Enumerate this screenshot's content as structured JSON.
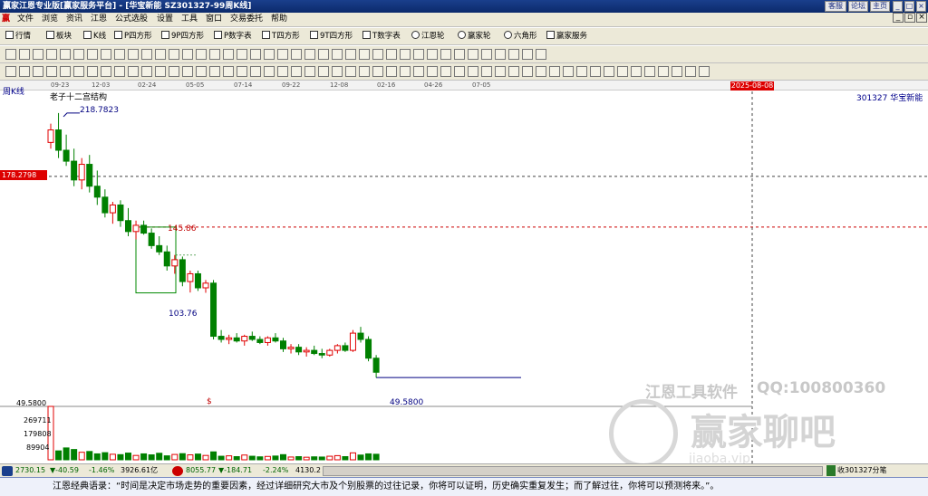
{
  "window": {
    "title": "赢家江恩专业版[赢家服务平台] - [华宝新能   SZ301327-99周K线]",
    "btn_advisor": "客服",
    "btn_forum": "论坛",
    "btn_home": "主页"
  },
  "menu": [
    "文件",
    "浏览",
    "资讯",
    "江恩",
    "公式选股",
    "设置",
    "工具",
    "窗口",
    "交易委托",
    "帮助"
  ],
  "toolbar1": [
    "行情",
    "板块",
    "K线",
    "P四方形",
    "9P四方形",
    "P数字表",
    "T四方形",
    "9T四方形",
    "T数字表",
    "江恩轮",
    "赢家轮",
    "六角形",
    "赢家服务"
  ],
  "chart": {
    "period_label": "周K线",
    "study_label": "老子十二宫结构",
    "stock_label": "301327  华宝新能",
    "date_ticks": [
      "09-23",
      "12-03",
      "02-24",
      "05-05",
      "07-14",
      "09-22",
      "12-08",
      "02-16",
      "04-26",
      "07-05"
    ],
    "cursor_date": "2025-08-08",
    "cursor_price": "178.2798",
    "high_label": "218.7823",
    "level_label": "145.86",
    "box_low_label": "103.76",
    "low_label": "49.5800",
    "dollar_mark": "$",
    "volume_axis": [
      "49.5800",
      "269711",
      "179808",
      "89904"
    ],
    "watermark_1": "江恩工具软件",
    "watermark_2": "QQ:100800360",
    "watermark_3": "赢家聊吧",
    "watermark_4": "jiaoba.vip"
  },
  "status": {
    "sh_index": "2730.15",
    "sh_change": "▼-40.59",
    "sh_pct": "-1.46%",
    "sh_amount": "3926.61亿",
    "sz_index": "8055.77",
    "sz_change": "▼-184.71",
    "sz_pct": "-2.24%",
    "sz_amount": "4130.2",
    "tab": "收301327分笔"
  },
  "footer": {
    "quote": "江恩经典语录：“时间是决定市场走势的重要因素，经过详细研究大市及个别股票的过往记录，你将可以证明，历史确实重复发生；而了解过往，你将可以预测将来。”。"
  },
  "chart_data": {
    "type": "candlestick",
    "title": "",
    "candles": [
      [
        200,
        212,
        196,
        208
      ],
      [
        208,
        218.8,
        190,
        195
      ],
      [
        195,
        205,
        185,
        188
      ],
      [
        188,
        196,
        172,
        176
      ],
      [
        176,
        190,
        170,
        186
      ],
      [
        186,
        192,
        168,
        172
      ],
      [
        172,
        182,
        160,
        165
      ],
      [
        165,
        170,
        152,
        155
      ],
      [
        155,
        162,
        148,
        160
      ],
      [
        160,
        163,
        146,
        150
      ],
      [
        150,
        158,
        140,
        143
      ],
      [
        143,
        150,
        138,
        147
      ],
      [
        147,
        150,
        141,
        142
      ],
      [
        142,
        145,
        132,
        134
      ],
      [
        134,
        140,
        128,
        130
      ],
      [
        130,
        134,
        118,
        121
      ],
      [
        121,
        128,
        116,
        125
      ],
      [
        125,
        127,
        108,
        111
      ],
      [
        111,
        118,
        104,
        116
      ],
      [
        116,
        118,
        105,
        107
      ],
      [
        107,
        112,
        103.8,
        110
      ],
      [
        110,
        112,
        74,
        76
      ],
      [
        76,
        80,
        72,
        74
      ],
      [
        74,
        77,
        71,
        75
      ],
      [
        75,
        78,
        72,
        73
      ],
      [
        73,
        77,
        70,
        76
      ],
      [
        76,
        79,
        73,
        74
      ],
      [
        74,
        76,
        71,
        72
      ],
      [
        72,
        76,
        70,
        75
      ],
      [
        75,
        78,
        72,
        73
      ],
      [
        73,
        75,
        66,
        68
      ],
      [
        68,
        71,
        65,
        69
      ],
      [
        69,
        71,
        64,
        66
      ],
      [
        66,
        69,
        63,
        67
      ],
      [
        67,
        70,
        64,
        65
      ],
      [
        65,
        68,
        62,
        64
      ],
      [
        64,
        68,
        63,
        67
      ],
      [
        67,
        71,
        65,
        70
      ],
      [
        70,
        72,
        66,
        67
      ],
      [
        67,
        80,
        66,
        78
      ],
      [
        78,
        82,
        72,
        74
      ],
      [
        74,
        76,
        60,
        62
      ],
      [
        62,
        64,
        49.58,
        53
      ]
    ],
    "volume": [
      269711,
      45000,
      60000,
      52000,
      38000,
      42000,
      30000,
      36000,
      28000,
      26000,
      34000,
      22000,
      30000,
      25000,
      33000,
      20000,
      27000,
      31000,
      25000,
      29000,
      22000,
      40000,
      18000,
      20000,
      16000,
      24000,
      18000,
      15000,
      17000,
      19000,
      26000,
      14000,
      16000,
      13000,
      15000,
      14000,
      18000,
      21000,
      16000,
      35000,
      24000,
      30000,
      28000
    ],
    "price_range": [
      30,
      228
    ],
    "volume_ticks": [
      269711,
      179808,
      89904
    ]
  }
}
